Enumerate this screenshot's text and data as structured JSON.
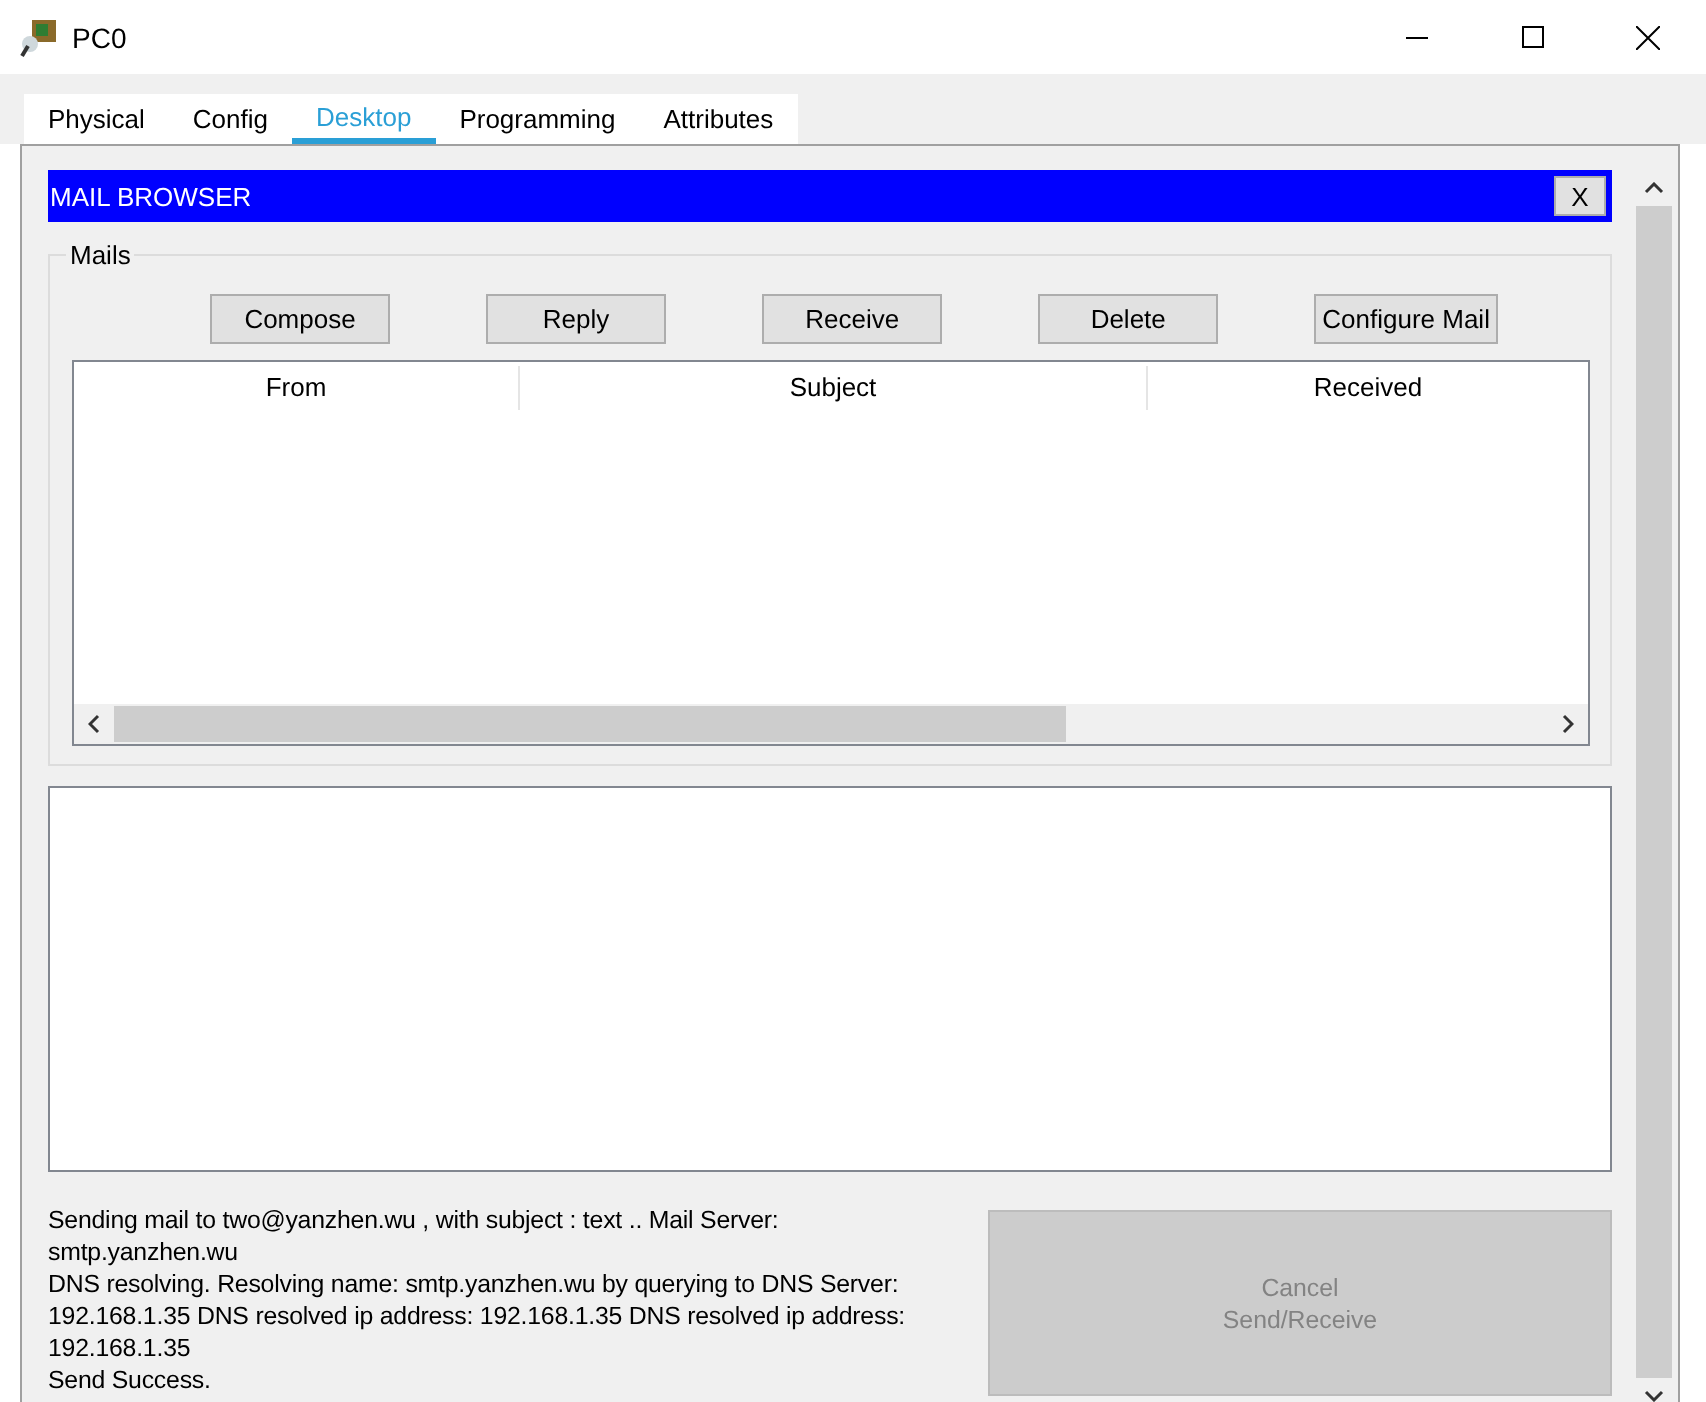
{
  "window": {
    "title": "PC0"
  },
  "tabs": [
    {
      "label": "Physical",
      "selected": false
    },
    {
      "label": "Config",
      "selected": false
    },
    {
      "label": "Desktop",
      "selected": true
    },
    {
      "label": "Programming",
      "selected": false
    },
    {
      "label": "Attributes",
      "selected": false
    }
  ],
  "mail_browser": {
    "title": "MAIL BROWSER",
    "close_label": "X",
    "group_label": "Mails",
    "buttons": [
      {
        "label": "Compose"
      },
      {
        "label": "Reply"
      },
      {
        "label": "Receive"
      },
      {
        "label": "Delete"
      },
      {
        "label": "Configure Mail"
      }
    ],
    "columns": [
      "From",
      "Subject",
      "Received"
    ],
    "log_lines": [
      "Sending mail to two@yanzhen.wu , with subject : text ..   Mail Server:",
      "smtp.yanzhen.wu",
      "DNS resolving. Resolving name: smtp.yanzhen.wu by querying to DNS Server:",
      "192.168.1.35  DNS resolved ip address: 192.168.1.35  DNS resolved ip address:",
      "192.168.1.35",
      "Send Success."
    ],
    "cancel_button": {
      "label": "Cancel Send/Receive",
      "disabled": true
    }
  }
}
